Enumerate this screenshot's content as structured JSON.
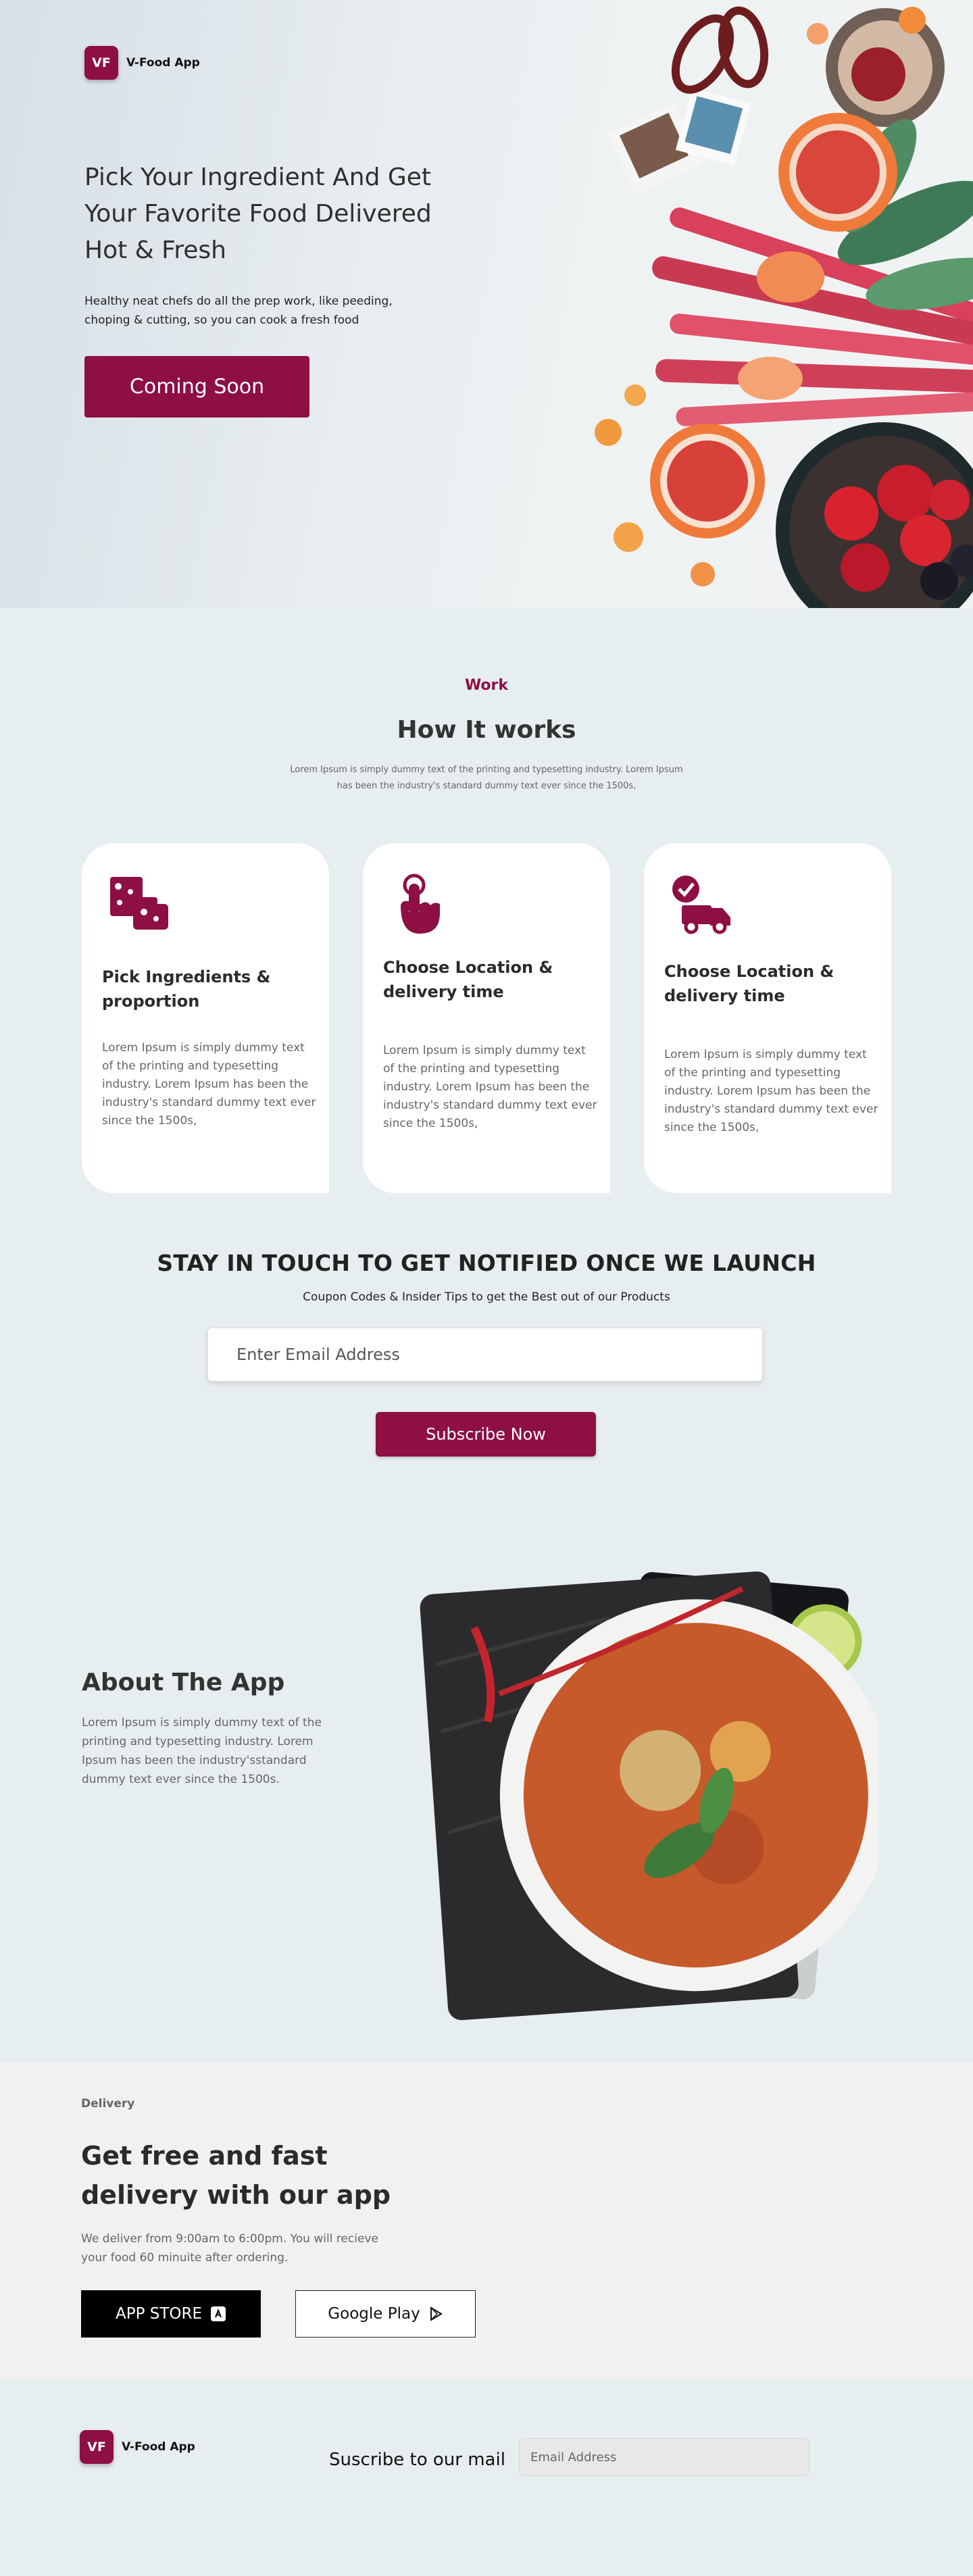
{
  "brand": {
    "mark": "VF",
    "name": "V-Food App"
  },
  "hero": {
    "title": "Pick Your Ingredient And Get Your Favorite Food Delivered Hot & Fresh",
    "subtitle": "Healthy neat chefs do all the prep work, like peeding, choping & cutting, so you can cook a fresh food",
    "cta": "Coming Soon"
  },
  "how": {
    "kicker": "Work",
    "title": "How It works",
    "description": "Lorem Ipsum is simply dummy text of the printing and typesetting industry. Lorem Ipsum has been the industry's standard dummy text ever since the 1500s,",
    "cards": [
      {
        "icon": "ingredients-icon",
        "title": "Pick Ingredients & proportion",
        "text": "Lorem Ipsum is simply dummy text of the printing and typesetting industry. Lorem Ipsum has been the industry's standard dummy text ever since the 1500s,"
      },
      {
        "icon": "tap-location-icon",
        "title": "Choose Location & delivery time",
        "text": "Lorem Ipsum is simply dummy text of the printing and typesetting industry. Lorem Ipsum has been the industry's standard dummy text ever since the 1500s,"
      },
      {
        "icon": "delivery-truck-icon",
        "title": "Choose Location & delivery time",
        "text": "Lorem Ipsum is simply dummy text of the printing and typesetting industry. Lorem Ipsum has been the industry's standard dummy text ever since the 1500s,"
      }
    ]
  },
  "newsletter": {
    "title": "STAY IN TOUCH TO GET NOTIFIED ONCE WE LAUNCH",
    "subtitle": "Coupon Codes & Insider Tips to get the Best out of our Products",
    "placeholder": "Enter Email Address",
    "button": "Subscribe Now"
  },
  "about": {
    "title": "About The App",
    "text": "Lorem Ipsum is simply dummy text of the printing and typesetting industry. Lorem Ipsum has been the industry'sstandard dummy text ever since the 1500s."
  },
  "delivery": {
    "kicker": "Delivery",
    "title": "Get free and fast delivery with our app",
    "text": "We deliver from 9:00am to 6:00pm. You will recieve your food 60 minuite after ordering.",
    "app_store": "APP STORE",
    "google_play": "Google Play"
  },
  "footer": {
    "subscribe_label": "Suscribe to our mail",
    "placeholder": "Email Address"
  },
  "colors": {
    "accent": "#8d0f44",
    "background": "#e7eef0",
    "delivery_bg": "#f1f1f1"
  }
}
